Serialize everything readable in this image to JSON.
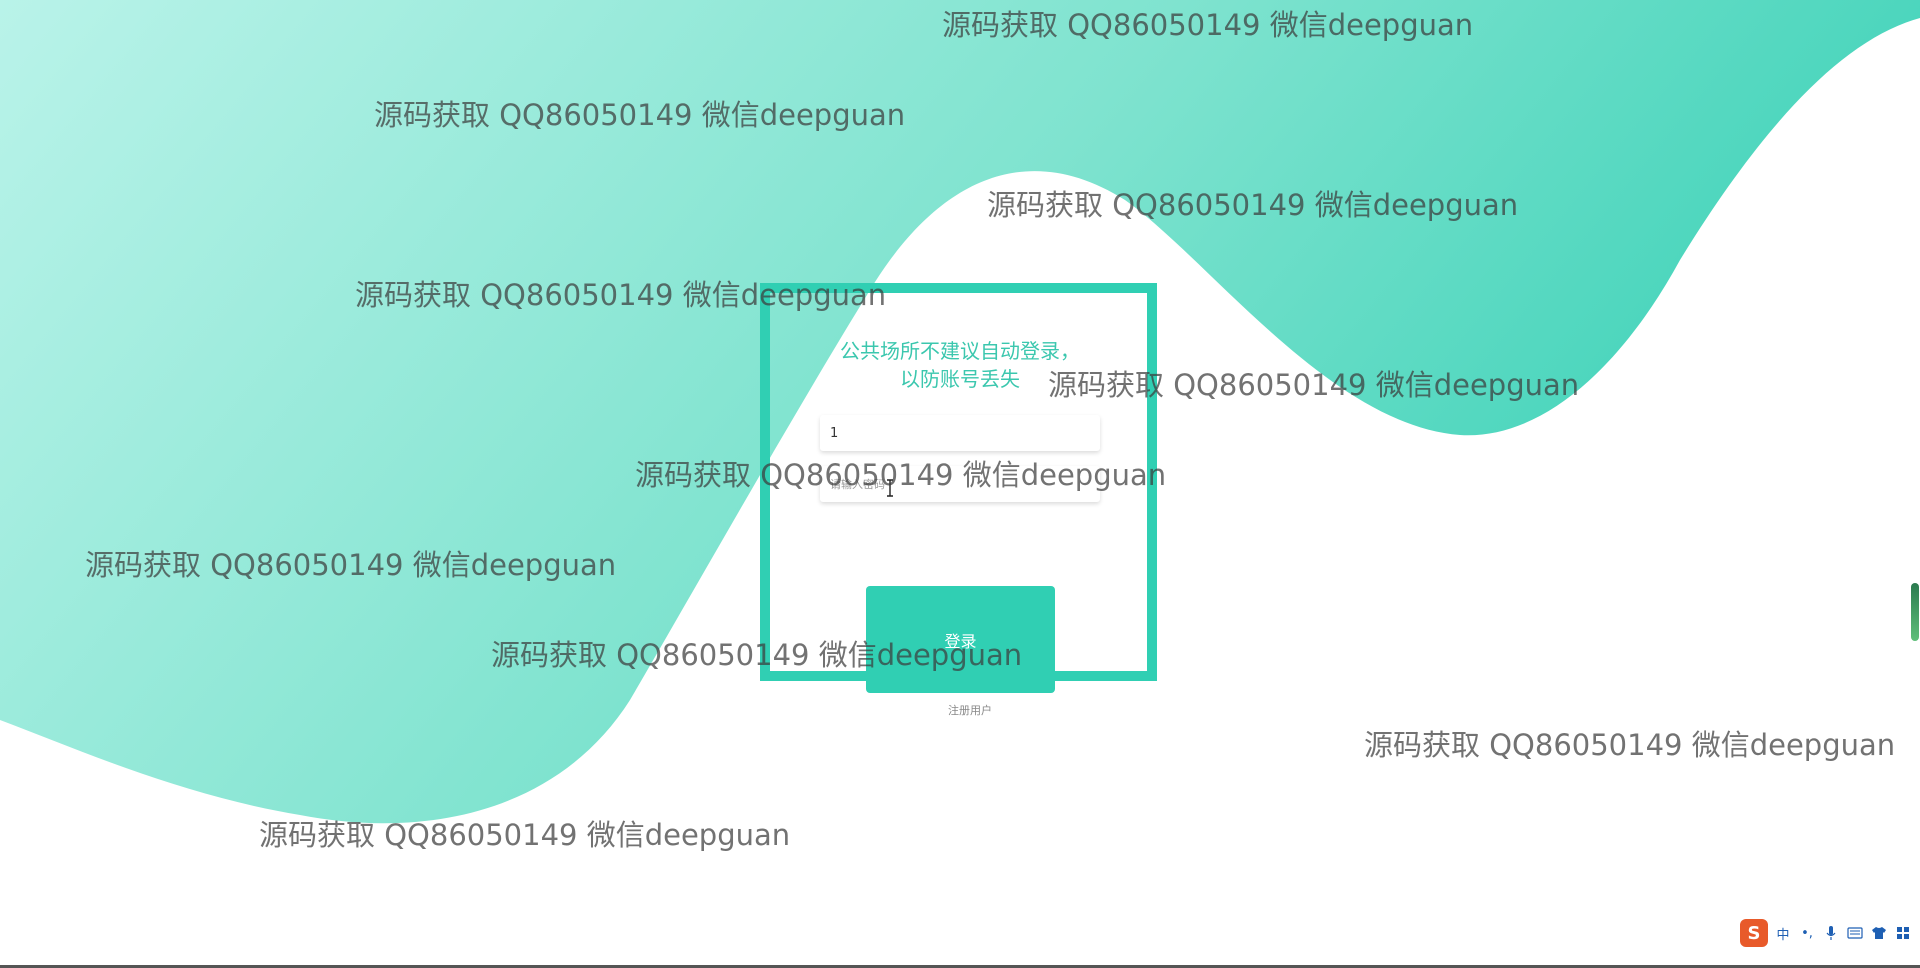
{
  "colors": {
    "accent": "#30cfb3",
    "wave_light": "#b9f3e9",
    "wave_dark": "#3dd2b8",
    "hint_text": "#3bc7ae",
    "background": "#ffffff"
  },
  "login": {
    "hint_line1": "公共场所不建议自动登录，",
    "hint_line2": "以防账号丢失",
    "username_value": "1",
    "password_placeholder": "请输入密码",
    "login_label": "登录",
    "register_label": "注册用户"
  },
  "watermarks": [
    "源码获取 QQ86050149 微信deepguan",
    "源码获取 QQ86050149 微信deepguan",
    "源码获取 QQ86050149 微信deepguan",
    "源码获取 QQ86050149 微信deepguan",
    "源码获取 QQ86050149 微信deepguan",
    "源码获取 QQ86050149 微信deepguan",
    "源码获取 QQ86050149 微信deepguan",
    "源码获取 QQ86050149 微信deepguan",
    "源码获取 QQ86050149 微信deepguan",
    "源码获取 QQ86050149 微信deepguan"
  ],
  "ime": {
    "logo": "S",
    "mode": "中",
    "punct": "•,",
    "icons": [
      "microphone-icon",
      "keyboard-icon",
      "shirt-icon",
      "grid-icon"
    ]
  }
}
